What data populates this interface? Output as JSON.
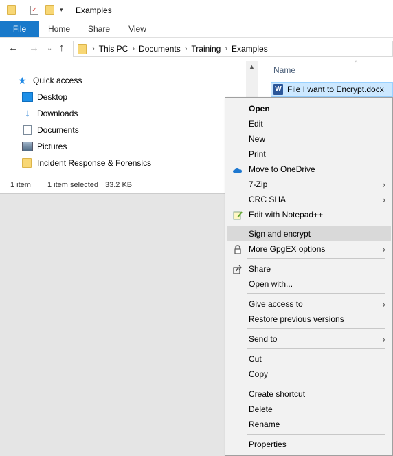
{
  "window": {
    "title": "Examples"
  },
  "ribbon": {
    "tabs": [
      "File",
      "Home",
      "Share",
      "View"
    ]
  },
  "address": {
    "crumbs": [
      "This PC",
      "Documents",
      "Training",
      "Examples"
    ]
  },
  "nav": {
    "quick_access": "Quick access",
    "items": [
      "Desktop",
      "Downloads",
      "Documents",
      "Pictures",
      "Incident Response & Forensics"
    ]
  },
  "status": {
    "count": "1 item",
    "selected": "1 item selected",
    "size": "33.2 KB"
  },
  "filelist": {
    "column_name": "Name",
    "files": [
      {
        "name": "File I want to Encrypt.docx",
        "icon": "word-doc-icon"
      }
    ]
  },
  "context_menu": {
    "groups": [
      [
        "Open",
        "Edit",
        "New",
        "Print",
        "Move to OneDrive",
        "7-Zip",
        "CRC SHA",
        "Edit with Notepad++"
      ],
      [
        "Sign and encrypt",
        "More GpgEX options"
      ],
      [
        "Share",
        "Open with..."
      ],
      [
        "Give access to",
        "Restore previous versions"
      ],
      [
        "Send to"
      ],
      [
        "Cut",
        "Copy"
      ],
      [
        "Create shortcut",
        "Delete",
        "Rename"
      ],
      [
        "Properties"
      ]
    ]
  },
  "colors": {
    "accent": "#1979ca",
    "selection": "#cce8ff",
    "folder": "#f8d775",
    "highlight": "#d9d9d9"
  }
}
